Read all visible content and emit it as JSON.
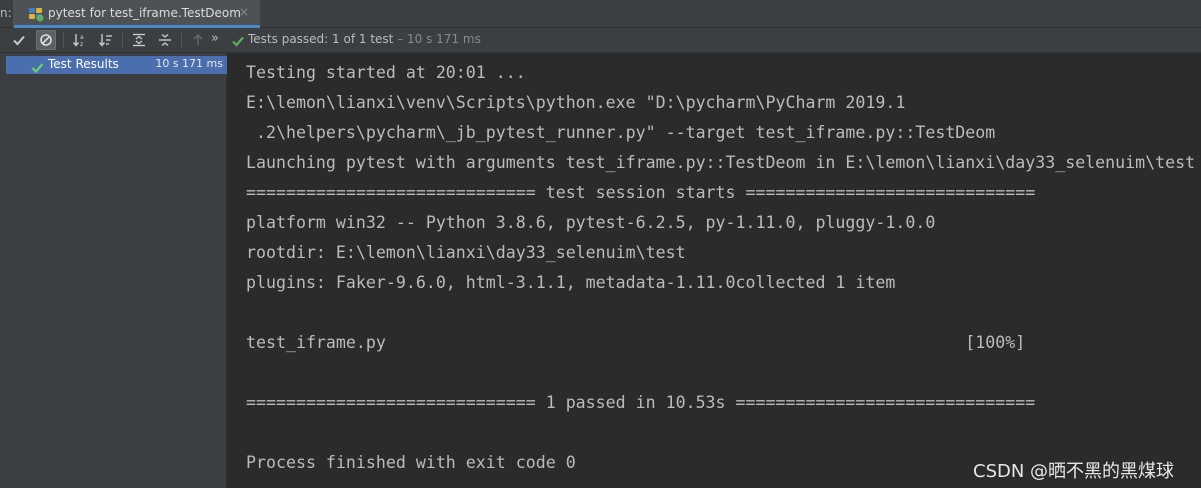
{
  "tab": {
    "run_label": "n:",
    "title": "pytest for test_iframe.TestDeom",
    "close": "×"
  },
  "toolbar": {
    "more": "»",
    "status_label": "Tests passed:",
    "status_count": "1 of 1 test",
    "status_time": "– 10 s 171 ms"
  },
  "tree": {
    "root_label": "Test Results",
    "root_time": "10 s 171 ms"
  },
  "console": {
    "lines": [
      "Testing started at 20:01 ...",
      "E:\\lemon\\lianxi\\venv\\Scripts\\python.exe \"D:\\pycharm\\PyCharm 2019.1",
      " .2\\helpers\\pycharm\\_jb_pytest_runner.py\" --target test_iframe.py::TestDeom",
      "Launching pytest with arguments test_iframe.py::TestDeom in E:\\lemon\\lianxi\\day33_selenuim\\test",
      "============================= test session starts =============================",
      "platform win32 -- Python 3.8.6, pytest-6.2.5, py-1.11.0, pluggy-1.0.0",
      "rootdir: E:\\lemon\\lianxi\\day33_selenuim\\test",
      "plugins: Faker-9.6.0, html-3.1.1, metadata-1.11.0collected 1 item",
      "",
      "test_iframe.py                                                          [100%]",
      "",
      "============================= 1 passed in 10.53s ==============================",
      "",
      "Process finished with exit code 0"
    ]
  },
  "watermark": "CSDN @晒不黑的黑煤球",
  "colors": {
    "pass_green": "#5faf5f",
    "selection": "#4b6eaf",
    "panel_bg": "#3c3f41",
    "console_bg": "#2b2b2b"
  }
}
